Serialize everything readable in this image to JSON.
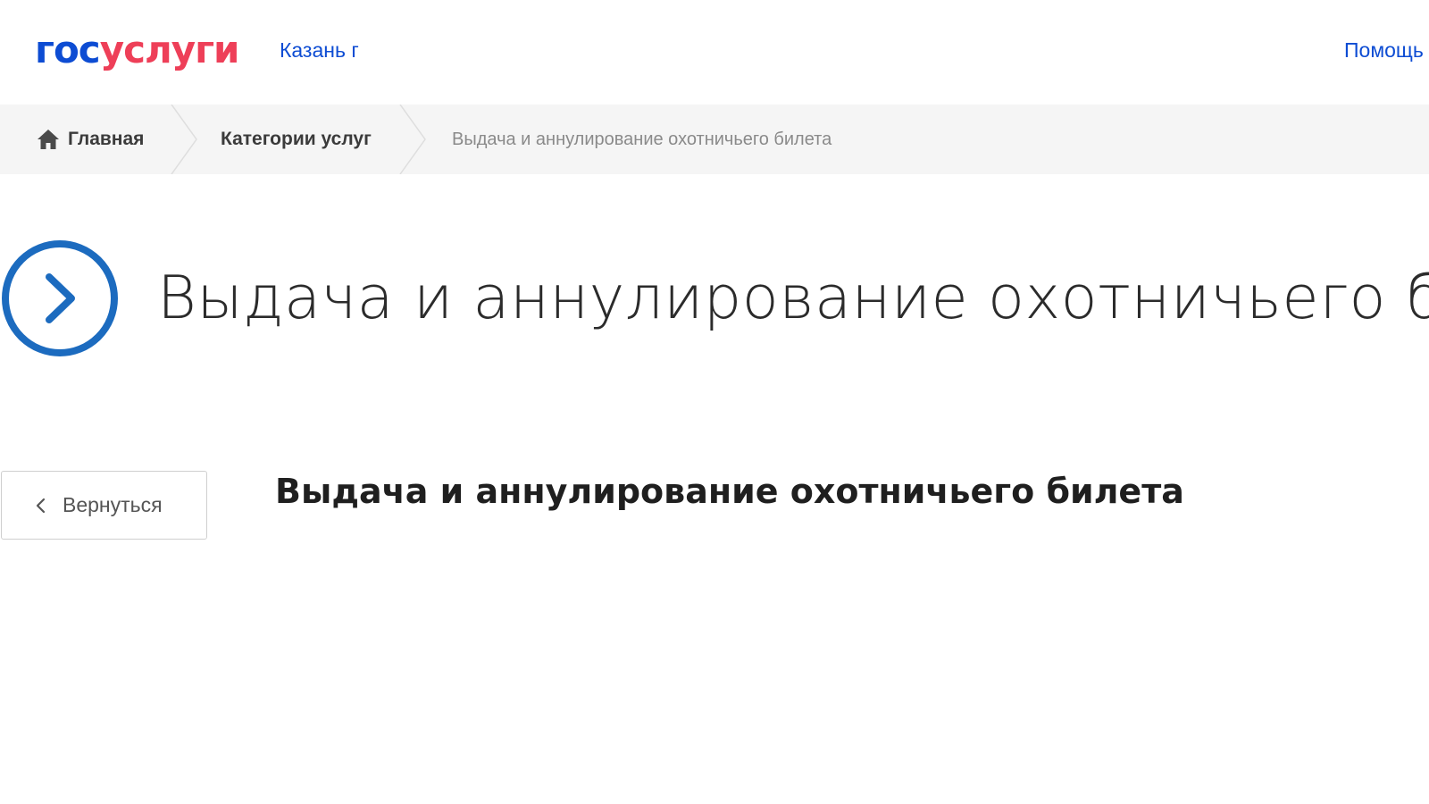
{
  "header": {
    "logo_part1": "гос",
    "logo_part2": "услуги",
    "region": "Казань г",
    "help": "Помощь"
  },
  "breadcrumbs": {
    "home": "Главная",
    "categories": "Категории услуг",
    "current": "Выдача и аннулирование охотничьего билета"
  },
  "main": {
    "title": "Выдача и аннулирование охотничьего билета",
    "back_label": "Вернуться",
    "subtitle": "Выдача и аннулирование охотничьего билета"
  },
  "colors": {
    "brand_blue": "#0d4cd3",
    "brand_red": "#ee3f58",
    "icon_blue": "#1c6bbf"
  },
  "icons": {
    "home": "home-icon",
    "title": "chevron-circle-right-icon",
    "back": "chevron-left-icon"
  }
}
